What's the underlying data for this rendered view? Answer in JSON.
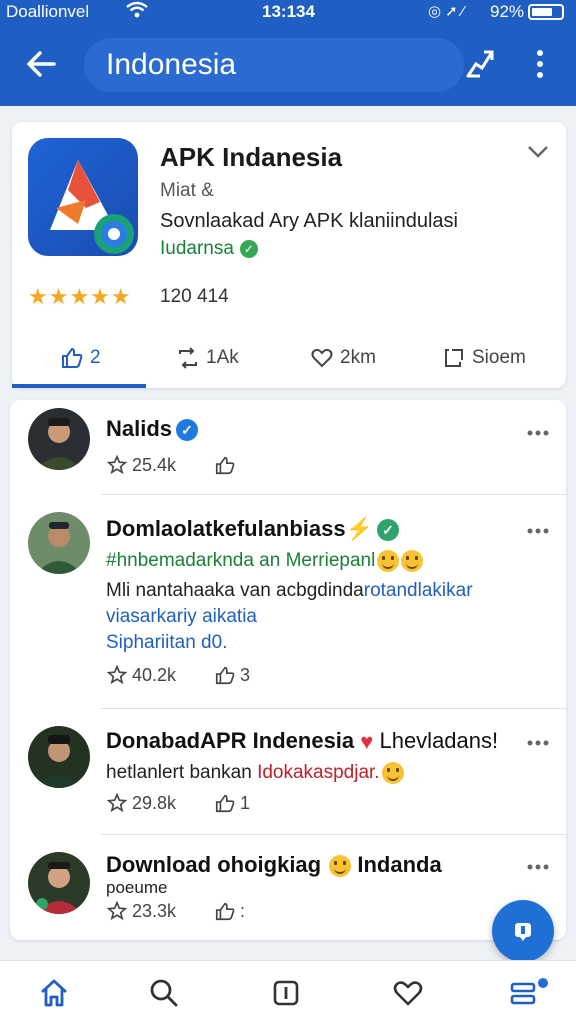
{
  "status_bar": {
    "carrier": "Doallionvel",
    "time": "13:134",
    "battery": "92%"
  },
  "app_bar": {
    "title": "Indonesia"
  },
  "app_card": {
    "name": "APK Indanesia",
    "meta": "Miat &",
    "description": "Sovnlaakad Ary APK klaniindulasi",
    "developer": "Iudarnsa",
    "rating_count": "120 414",
    "tabs": [
      {
        "label": "2",
        "icon": "thumbs-up-icon"
      },
      {
        "label": "1Ak",
        "icon": "repost-icon"
      },
      {
        "label": "2km",
        "icon": "heart-icon"
      },
      {
        "label": "Sioem",
        "icon": "share-box-icon"
      }
    ]
  },
  "posts": [
    {
      "name": "Nalids",
      "verified": "blue",
      "likes": "25.4k",
      "shares": ""
    },
    {
      "name": "Domlaolatkefulanbiass",
      "verified": "green",
      "hashtag": "#hnbemadarknda an Merriepanl",
      "body1": "Mli nantahaaka van acbgdinda",
      "body1_link": "rotandlakikar",
      "body2": "viasarkariy aikatia",
      "body3": "Siphariitan d0.",
      "likes": "40.2k",
      "shares": "3"
    },
    {
      "name": "DonabadAPR Indenesia",
      "name_suffix": "Lhevladans!",
      "body1": "hetlanlert bankan",
      "body1_red": "Idokakaspdjar.",
      "likes": "29.8k",
      "shares": "1"
    },
    {
      "name": "Download ohoigkiag",
      "name_suffix": "Indanda",
      "body1": "poeume",
      "likes": "23.3k",
      "shares": ":"
    }
  ],
  "colors": {
    "primary": "#1f5fc4",
    "verified_blue": "#1f7ae0",
    "verified_green": "#2fa36b",
    "star": "#f6a623"
  }
}
